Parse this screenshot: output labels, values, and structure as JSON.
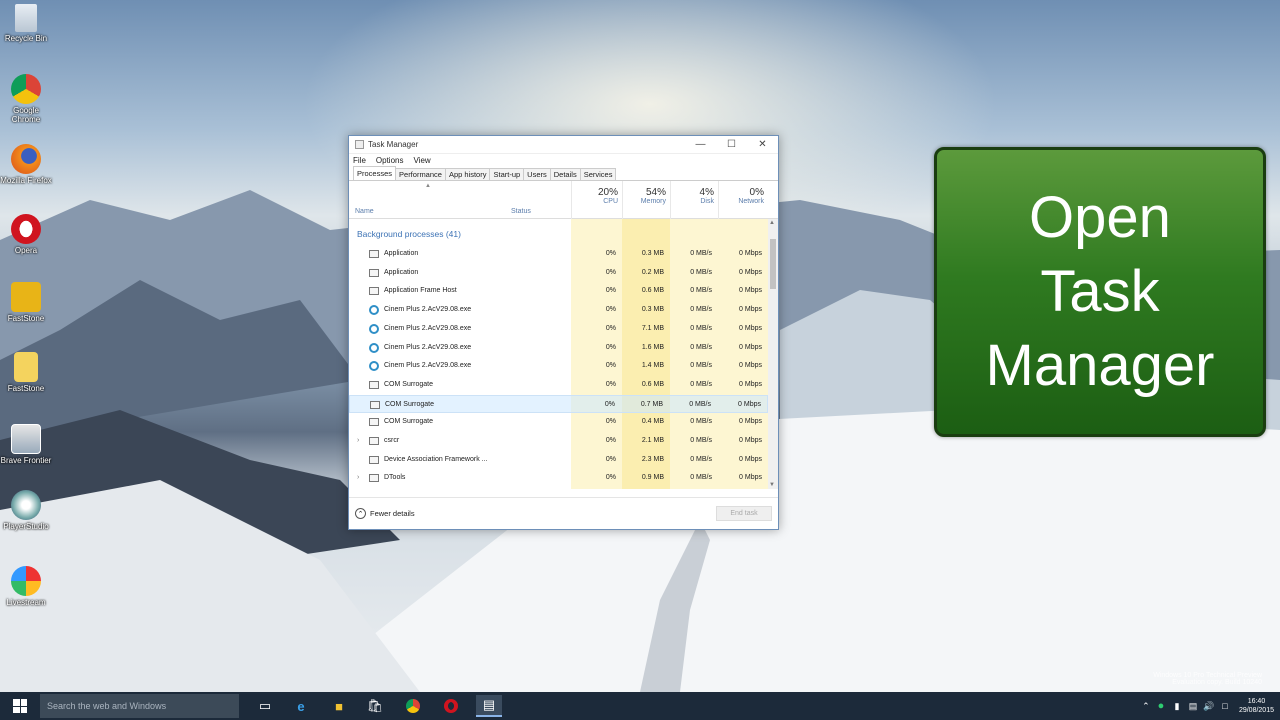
{
  "desktop": {
    "icons": [
      {
        "label": "Recycle Bin",
        "icon": "recycle-bin-icon"
      },
      {
        "label": "Google Chrome",
        "icon": "chrome-icon"
      },
      {
        "label": "Mozilla Firefox",
        "icon": "firefox-icon"
      },
      {
        "label": "Opera",
        "icon": "opera-icon"
      },
      {
        "label": "FastStone",
        "icon": "faststone-icon"
      },
      {
        "label": "FastStone",
        "icon": "folder-icon"
      },
      {
        "label": "Brave Frontier",
        "icon": "brave-frontier-icon"
      },
      {
        "label": "PlayerStudio",
        "icon": "playerstudio-icon"
      },
      {
        "label": "Livestream",
        "icon": "livestream-icon"
      }
    ]
  },
  "task_manager": {
    "title": "Task Manager",
    "menu": [
      "File",
      "Options",
      "View"
    ],
    "tabs": [
      "Processes",
      "Performance",
      "App history",
      "Start-up",
      "Users",
      "Details",
      "Services"
    ],
    "active_tab": "Processes",
    "columns": {
      "name": "Name",
      "status": "Status",
      "cpu": {
        "pct": "20%",
        "label": "CPU"
      },
      "memory": {
        "pct": "54%",
        "label": "Memory"
      },
      "disk": {
        "pct": "4%",
        "label": "Disk"
      },
      "network": {
        "pct": "0%",
        "label": "Network"
      }
    },
    "group": "Background processes (41)",
    "rows": [
      {
        "name": "Application",
        "cpu": "0%",
        "memory": "0.3 MB",
        "disk": "0 MB/s",
        "network": "0 Mbps",
        "icon": "window"
      },
      {
        "name": "Application",
        "cpu": "0%",
        "memory": "0.2 MB",
        "disk": "0 MB/s",
        "network": "0 Mbps",
        "icon": "window"
      },
      {
        "name": "Application Frame Host",
        "cpu": "0%",
        "memory": "0.6 MB",
        "disk": "0 MB/s",
        "network": "0 Mbps",
        "icon": "window"
      },
      {
        "name": "Cinem Plus 2.AcV29.08.exe",
        "cpu": "0%",
        "memory": "0.3 MB",
        "disk": "0 MB/s",
        "network": "0 Mbps",
        "icon": "blue"
      },
      {
        "name": "Cinem Plus 2.AcV29.08.exe",
        "cpu": "0%",
        "memory": "7.1 MB",
        "disk": "0 MB/s",
        "network": "0 Mbps",
        "icon": "blue"
      },
      {
        "name": "Cinem Plus 2.AcV29.08.exe",
        "cpu": "0%",
        "memory": "1.6 MB",
        "disk": "0 MB/s",
        "network": "0 Mbps",
        "icon": "blue"
      },
      {
        "name": "Cinem Plus 2.AcV29.08.exe",
        "cpu": "0%",
        "memory": "1.4 MB",
        "disk": "0 MB/s",
        "network": "0 Mbps",
        "icon": "blue"
      },
      {
        "name": "COM Surrogate",
        "cpu": "0%",
        "memory": "0.6 MB",
        "disk": "0 MB/s",
        "network": "0 Mbps",
        "icon": "window"
      },
      {
        "name": "COM Surrogate",
        "cpu": "0%",
        "memory": "0.7 MB",
        "disk": "0 MB/s",
        "network": "0 Mbps",
        "icon": "window"
      },
      {
        "name": "COM Surrogate",
        "cpu": "0%",
        "memory": "0.4 MB",
        "disk": "0 MB/s",
        "network": "0 Mbps",
        "icon": "window"
      },
      {
        "name": "csrcr",
        "cpu": "0%",
        "memory": "2.1 MB",
        "disk": "0 MB/s",
        "network": "0 Mbps",
        "icon": "window",
        "expandable": true
      },
      {
        "name": "Device Association Framework ...",
        "cpu": "0%",
        "memory": "2.3 MB",
        "disk": "0 MB/s",
        "network": "0 Mbps",
        "icon": "window"
      },
      {
        "name": "DTools",
        "cpu": "0%",
        "memory": "0.9 MB",
        "disk": "0 MB/s",
        "network": "0 Mbps",
        "icon": "window",
        "expandable": true
      }
    ],
    "highlighted_row": 8,
    "fewer_details": "Fewer details",
    "end_task": "End task"
  },
  "panel": {
    "lines": [
      "Open",
      "Task",
      "Manager"
    ]
  },
  "taskbar": {
    "search_placeholder": "Search the web and Windows",
    "clock_time": "16:40",
    "clock_date": "29/08/2015"
  },
  "watermark": {
    "line1": "Windows 10 Pro Technical Preview",
    "line2": "Evaluation copy. Build 10240"
  },
  "colors": {
    "panel_green": "#2f7a20",
    "accent_blue": "#3d73b5",
    "taskbar": "#1c2a3a"
  }
}
